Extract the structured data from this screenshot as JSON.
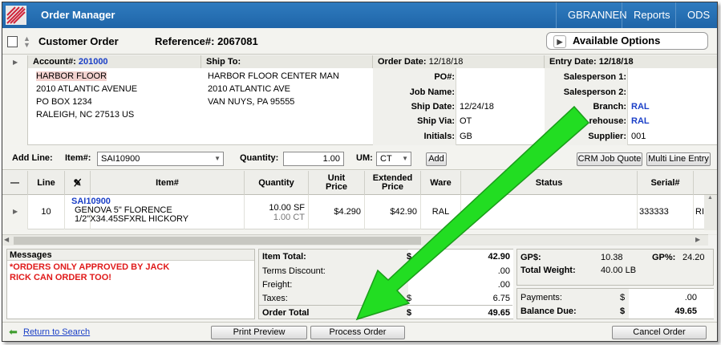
{
  "topbar": {
    "app_title": "Order Manager",
    "nav": [
      "GBRANNEN",
      "Reports",
      "ODS"
    ]
  },
  "header": {
    "title": "Customer Order",
    "reference_label": "Reference#:",
    "reference_value": "2067081",
    "options_label": "Available Options"
  },
  "account": {
    "label": "Account#:",
    "number": "201000",
    "lines": [
      "HARBOR FLOOR",
      "2010 ATLANTIC AVENUE",
      "PO BOX 1234",
      "RALEIGH, NC 27513 US"
    ]
  },
  "ship_to": {
    "label": "Ship To:",
    "lines": [
      "HARBOR FLOOR CENTER MAN",
      "2010 ATLANTIC AVE",
      "VAN NUYS, PA 95555"
    ]
  },
  "order": {
    "order_date_label": "Order Date:",
    "order_date": "12/18/18",
    "po_label": "PO#:",
    "po": "",
    "job_label": "Job Name:",
    "job": "",
    "ship_date_label": "Ship Date:",
    "ship_date": "12/24/18",
    "ship_via_label": "Ship Via:",
    "ship_via": "OT",
    "initials_label": "Initials:",
    "initials": "GB"
  },
  "entry": {
    "entry_date_label": "Entry Date:",
    "entry_date": "12/18/18",
    "sales1_label": "Salesperson 1:",
    "sales1": "",
    "sales2_label": "Salesperson 2:",
    "sales2": "",
    "branch_label": "Branch:",
    "branch": "RAL",
    "warehouse_label": "rehouse:",
    "warehouse": "RAL",
    "supplier_label": "Supplier:",
    "supplier": "001"
  },
  "addline": {
    "label": "Add Line:",
    "item_label": "Item#:",
    "item_value": "SAI10900",
    "qty_label": "Quantity:",
    "qty_value": "1.00",
    "um_label": "UM:",
    "um_value": "CT",
    "add_button": "Add",
    "crm_button": "CRM Job Quote",
    "multi_button": "Multi Line Entry"
  },
  "grid": {
    "headers": {
      "dash": "—",
      "line": "Line",
      "item": "Item#",
      "qty": "Quantity",
      "unit": "Unit\nPrice",
      "ext": "Extended\nPrice",
      "ware": "Ware",
      "status": "Status",
      "serial": "Serial#"
    },
    "row": {
      "line": "10",
      "item_code": "SAI10900",
      "desc1": "GENOVA 5\" FLORENCE",
      "desc2": "1/2\"X34.45SFXRL HICKORY",
      "qty1": "10.00 SF",
      "qty2": "1.00 CT",
      "unit": "$4.290",
      "ext": "$42.90",
      "ware": "RAL",
      "status": "",
      "serial": "333333",
      "extra": "RI"
    }
  },
  "messages": {
    "title": "Messages",
    "text1": "*ORDERS ONLY APPROVED BY JACK",
    "text2": "RICK CAN ORDER TOO!"
  },
  "totals": {
    "item_total_label": "Item Total:",
    "item_total_cur": "$",
    "item_total": "42.90",
    "terms_label": "Terms Discount:",
    "terms": ".00",
    "freight_label": "Freight:",
    "freight": ".00",
    "taxes_label": "Taxes:",
    "taxes_cur": "$",
    "taxes": "6.75",
    "order_total_label": "Order Total",
    "order_total_cur": "$",
    "order_total": "49.65"
  },
  "gp": {
    "gp_label": "GP$:",
    "gp": "10.38",
    "gp_pct_label": "GP%:",
    "gp_pct": "24.20",
    "weight_label": "Total Weight:",
    "weight": "40.00",
    "weight_unit": "LB",
    "payments_label": "Payments:",
    "payments_cur": "$",
    "payments": ".00",
    "balance_label": "Balance Due:",
    "balance_cur": "$",
    "balance": "49.65"
  },
  "footer": {
    "return_link": "Return to Search",
    "print_button": "Print Preview",
    "process_button": "Process Order",
    "cancel_button": "Cancel Order"
  },
  "colors": {
    "topbar": "#2f7bbf",
    "link_blue": "#1a3fc7",
    "message_red": "#e01a1a",
    "arrow_green": "#22dd22"
  }
}
